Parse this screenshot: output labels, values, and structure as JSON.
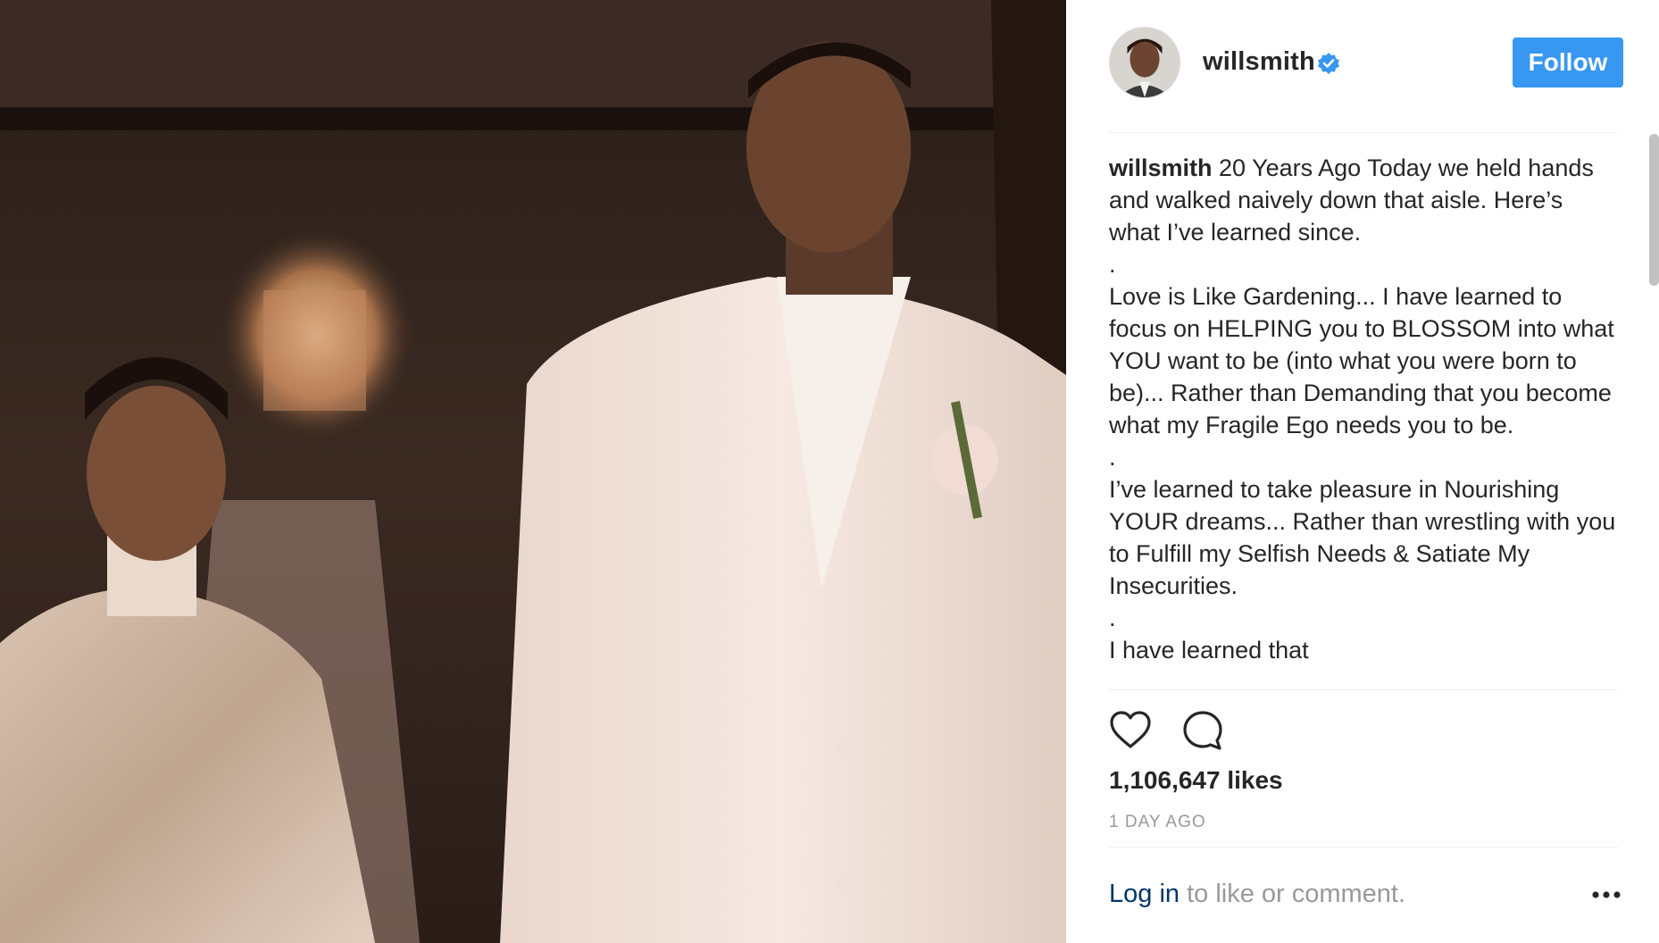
{
  "post": {
    "username": "willsmith",
    "verified": true,
    "follow_label": "Follow",
    "caption_author": "willsmith",
    "caption_lines": [
      "20 Years Ago Today we held hands and walked naively down that aisle. Here’s what I’ve learned since.",
      ".",
      "Love is Like Gardening... I have learned to focus on HELPING you to BLOSSOM into what YOU want to be (into what you were born to be)... Rather than Demanding that you become what my Fragile Ego needs you to be.",
      ".",
      "I’ve learned to take pleasure in Nourishing YOUR dreams... Rather than wrestling with you to Fulfill my Selfish Needs & Satiate My Insecurities.",
      ".",
      "I have learned that"
    ],
    "likes": "1,106,647 likes",
    "time": "1 DAY AGO",
    "login_link": "Log in",
    "login_text": " to like or comment."
  },
  "icons": {
    "avatar": "profile-photo",
    "verified": "verified-badge-icon",
    "like": "heart-icon",
    "comment": "comment-bubble-icon",
    "more": "more-options-icon"
  },
  "colors": {
    "follow_button": "#3897f0",
    "verified": "#3897f0",
    "link": "#003569",
    "muted": "#999999",
    "text": "#262626"
  }
}
